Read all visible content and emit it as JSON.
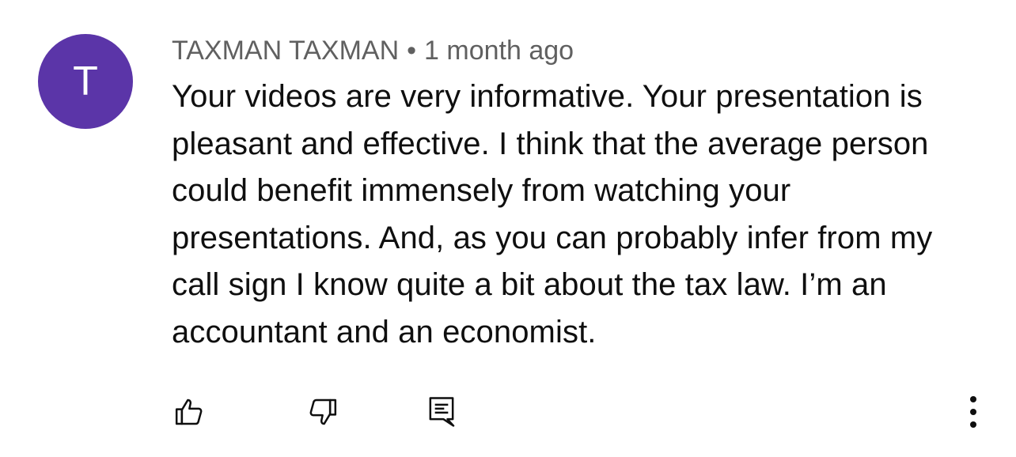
{
  "comment": {
    "avatar_letter": "T",
    "avatar_color": "#5b35a8",
    "author": "TAXMAN TAXMAN",
    "separator": "•",
    "timestamp": "1 month ago",
    "text": "Your videos are very informative. Your presentation is pleasant and effective. I think that the average person could benefit immensely from watching your presentations. And, as you can probably infer from my call sign I know quite a bit about the tax law. I’m an accountant and an economist."
  },
  "actions": {
    "like_icon": "thumbs-up-icon",
    "dislike_icon": "thumbs-down-icon",
    "reply_icon": "reply-comment-icon",
    "more_icon": "more-vertical-icon"
  }
}
